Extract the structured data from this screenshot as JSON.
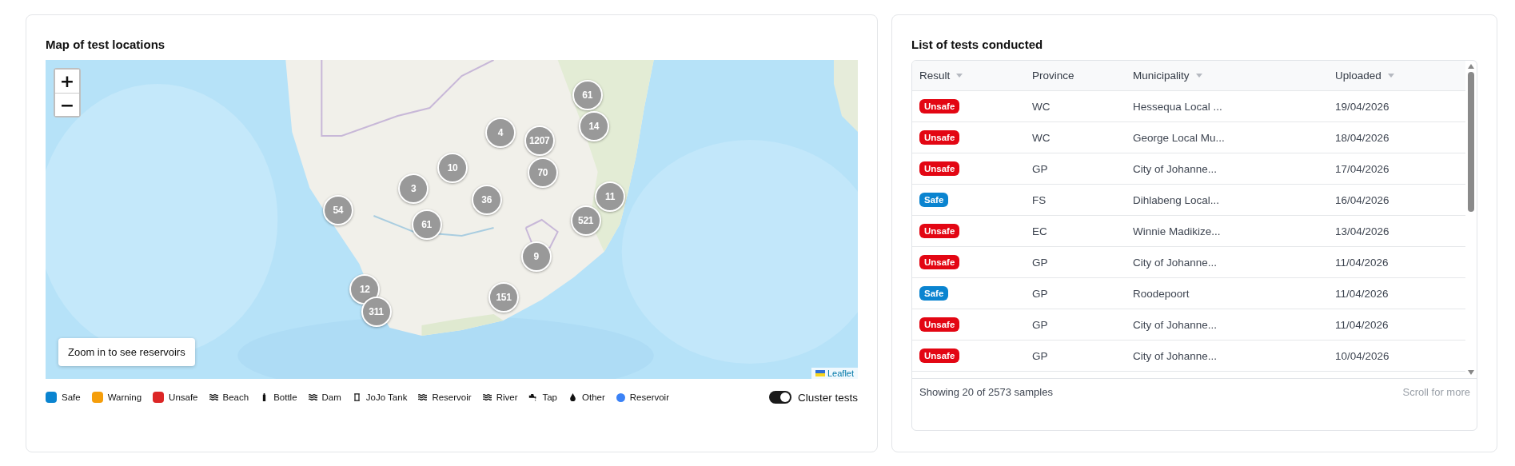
{
  "map_panel": {
    "title": "Map of test locations",
    "zoom_controls": [
      "+",
      "−"
    ],
    "clusters": [
      {
        "count": "61"
      },
      {
        "count": "14"
      },
      {
        "count": "4"
      },
      {
        "count": "1207"
      },
      {
        "count": "70"
      },
      {
        "count": "10"
      },
      {
        "count": "3"
      },
      {
        "count": "36"
      },
      {
        "count": "11"
      },
      {
        "count": "54"
      },
      {
        "count": "521"
      },
      {
        "count": "61"
      },
      {
        "count": "9"
      },
      {
        "count": "12"
      },
      {
        "count": "151"
      },
      {
        "count": "311"
      }
    ],
    "notice": "Zoom in to see reservoirs",
    "attribution": "Leaflet",
    "legend": [
      {
        "kind": "dot",
        "label": "Safe",
        "color": "#0a84d0"
      },
      {
        "kind": "dot",
        "label": "Warning",
        "color": "#f59e0b"
      },
      {
        "kind": "dot",
        "label": "Unsafe",
        "color": "#dc2626"
      },
      {
        "kind": "waves",
        "label": "Beach"
      },
      {
        "kind": "bottle",
        "label": "Bottle"
      },
      {
        "kind": "waves",
        "label": "Dam"
      },
      {
        "kind": "tank",
        "label": "JoJo Tank"
      },
      {
        "kind": "waves",
        "label": "Reservoir"
      },
      {
        "kind": "waves",
        "label": "River"
      },
      {
        "kind": "tap",
        "label": "Tap"
      },
      {
        "kind": "drop",
        "label": "Other"
      },
      {
        "kind": "circle",
        "label": "Reservoir",
        "color": "#3b82f6"
      }
    ],
    "cluster_toggle": {
      "label": "Cluster tests",
      "on": true
    }
  },
  "tests_panel": {
    "title": "List of tests conducted",
    "columns": [
      {
        "label": "Result",
        "sortable": true
      },
      {
        "label": "Province",
        "sortable": false
      },
      {
        "label": "Municipality",
        "sortable": true
      },
      {
        "label": "Uploaded",
        "sortable": true
      }
    ],
    "rows": [
      {
        "result": "Unsafe",
        "color": "#e30613",
        "province": "WC",
        "municipality": "Hessequa Local ...",
        "uploaded": "19/04/2026"
      },
      {
        "result": "Unsafe",
        "color": "#e30613",
        "province": "WC",
        "municipality": "George Local Mu...",
        "uploaded": "18/04/2026"
      },
      {
        "result": "Unsafe",
        "color": "#e30613",
        "province": "GP",
        "municipality": "City of Johanne...",
        "uploaded": "17/04/2026"
      },
      {
        "result": "Safe",
        "color": "#0a84d0",
        "province": "FS",
        "municipality": "Dihlabeng Local...",
        "uploaded": "16/04/2026"
      },
      {
        "result": "Unsafe",
        "color": "#e30613",
        "province": "EC",
        "municipality": "Winnie Madikize...",
        "uploaded": "13/04/2026"
      },
      {
        "result": "Unsafe",
        "color": "#e30613",
        "province": "GP",
        "municipality": "City of Johanne...",
        "uploaded": "11/04/2026"
      },
      {
        "result": "Safe",
        "color": "#0a84d0",
        "province": "GP",
        "municipality": "Roodepoort",
        "uploaded": "11/04/2026"
      },
      {
        "result": "Unsafe",
        "color": "#e30613",
        "province": "GP",
        "municipality": "City of Johanne...",
        "uploaded": "11/04/2026"
      },
      {
        "result": "Unsafe",
        "color": "#e30613",
        "province": "GP",
        "municipality": "City of Johanne...",
        "uploaded": "10/04/2026"
      }
    ],
    "summary": "Showing 20 of 2573 samples",
    "more_hint": "Scroll for more"
  }
}
